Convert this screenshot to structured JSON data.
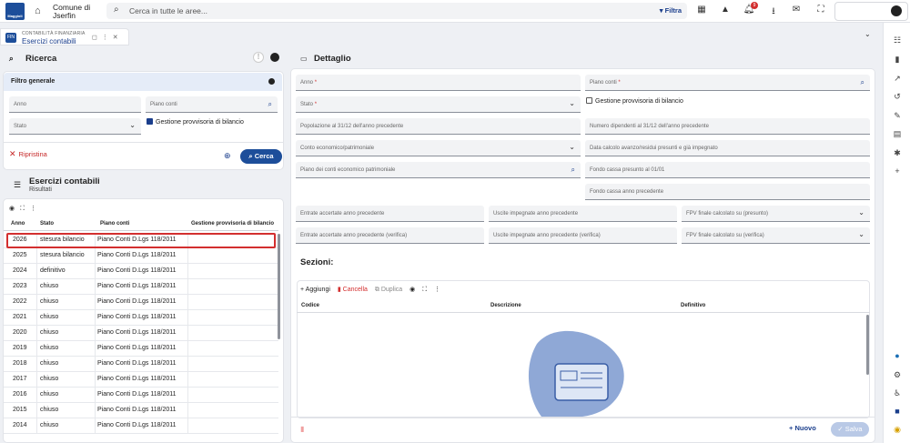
{
  "topbar": {
    "logo_text": "Maggioli",
    "comune_line1": "Comune di",
    "comune_line2": "Jserfin",
    "search_placeholder": "Cerca in tutte le aree...",
    "filtra_label": "Filtra",
    "notification_count": "9"
  },
  "tab": {
    "icon_text": "FIN",
    "subtitle": "CONTABILITÀ FINANZIARIA",
    "title": "Esercizi contabili"
  },
  "ricerca": {
    "title": "Ricerca",
    "filtro_title": "Filtro generale",
    "anno_label": "Anno",
    "piano_conti_label": "Piano conti",
    "stato_label": "Stato",
    "gestione_label": "Gestione provvisoria di bilancio",
    "ripristina_label": "Ripristina",
    "cerca_label": "Cerca"
  },
  "results": {
    "title": "Esercizi contabili",
    "subtitle": "Risultati",
    "columns": [
      "Anno",
      "Stato",
      "Piano conti",
      "Gestione provvisoria di bilancio"
    ],
    "rows": [
      {
        "anno": "2026",
        "stato": "stesura bilancio",
        "piano": "Piano Conti D.Lgs 118/2011"
      },
      {
        "anno": "2025",
        "stato": "stesura bilancio",
        "piano": "Piano Conti D.Lgs 118/2011"
      },
      {
        "anno": "2024",
        "stato": "definitivo",
        "piano": "Piano Conti D.Lgs 118/2011"
      },
      {
        "anno": "2023",
        "stato": "chiuso",
        "piano": "Piano Conti D.Lgs 118/2011"
      },
      {
        "anno": "2022",
        "stato": "chiuso",
        "piano": "Piano Conti D.Lgs 118/2011"
      },
      {
        "anno": "2021",
        "stato": "chiuso",
        "piano": "Piano Conti D.Lgs 118/2011"
      },
      {
        "anno": "2020",
        "stato": "chiuso",
        "piano": "Piano Conti D.Lgs 118/2011"
      },
      {
        "anno": "2019",
        "stato": "chiuso",
        "piano": "Piano Conti D.Lgs 118/2011"
      },
      {
        "anno": "2018",
        "stato": "chiuso",
        "piano": "Piano Conti D.Lgs 118/2011"
      },
      {
        "anno": "2017",
        "stato": "chiuso",
        "piano": "Piano Conti D.Lgs 118/2011"
      },
      {
        "anno": "2016",
        "stato": "chiuso",
        "piano": "Piano Conti D.Lgs 118/2011"
      },
      {
        "anno": "2015",
        "stato": "chiuso",
        "piano": "Piano Conti D.Lgs 118/2011"
      },
      {
        "anno": "2014",
        "stato": "chiuso",
        "piano": "Piano Conti D.Lgs 118/2011"
      }
    ]
  },
  "dettaglio": {
    "title": "Dettaglio",
    "anno": "Anno",
    "piano_conti": "Piano conti",
    "stato": "Stato",
    "gestione": "Gestione provvisoria di bilancio",
    "popolazione": "Popolazione al 31/12 dell'anno precedente",
    "dipendenti": "Numero dipendenti al 31/12 dell'anno precedente",
    "conto": "Conto economico/patrimoniale",
    "data_calcolo": "Data calcolo avanzo/residui presunti e già impegnato",
    "piano_economico": "Piano dei conti economico patrimoniale",
    "fondo_presunto": "Fondo cassa presunto al 01/01",
    "fondo_anno": "Fondo cassa anno precedente",
    "entrate": "Entrate accertate anno precedente",
    "uscite": "Uscite impegnate anno precedente",
    "fpv": "FPV finale calcolato su (presunto)",
    "entrate_ver": "Entrate accertate anno precedente (verifica)",
    "uscite_ver": "Uscite impegnate anno precedente (verifica)",
    "fpv_ver": "FPV finale calcolato su (verifica)"
  },
  "sezioni": {
    "title": "Sezioni:",
    "aggiungi": "Aggiungi",
    "cancella": "Cancella",
    "duplica": "Duplica",
    "col_codice": "Codice",
    "col_descrizione": "Descrizione",
    "col_definitivo": "Definitivo"
  },
  "footer": {
    "nuovo": "Nuovo",
    "salva": "Salva"
  },
  "colors": {
    "primary": "#1d4e9a",
    "danger": "#d32f2f",
    "filter_bg": "#e5ecf8"
  }
}
